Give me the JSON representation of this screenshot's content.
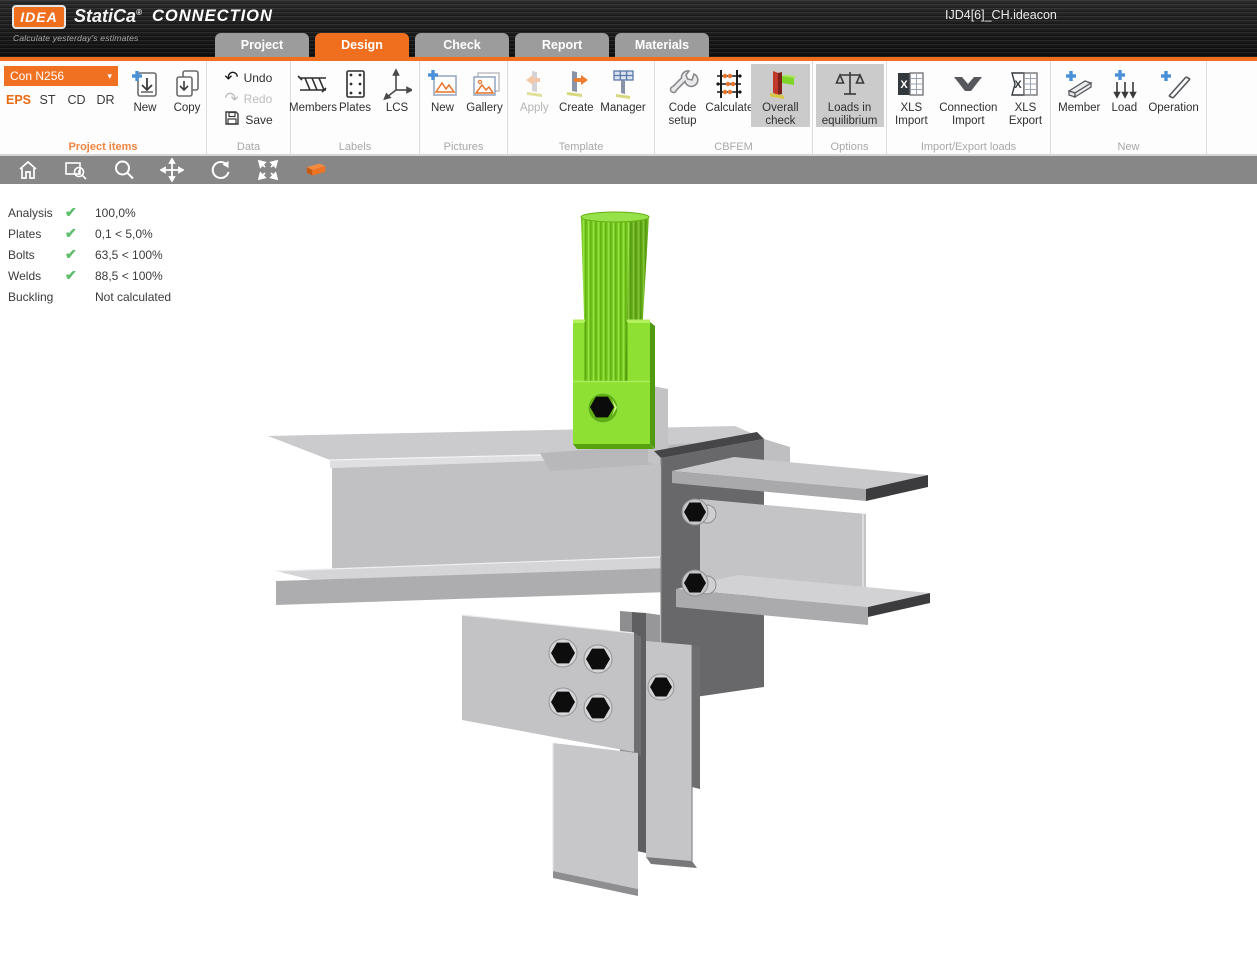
{
  "header": {
    "logo_primary": "IDEA",
    "logo_secondary": "StatiCa",
    "logo_trademark": "®",
    "tagline": "Calculate yesterday's estimates",
    "app_name": "CONNECTION",
    "document_title": "IJD4[6]_CH.ideacon",
    "tabs": [
      {
        "label": "Project"
      },
      {
        "label": "Design"
      },
      {
        "label": "Check"
      },
      {
        "label": "Report"
      },
      {
        "label": "Materials"
      }
    ]
  },
  "ribbon": {
    "project_items": {
      "caption": "Project items",
      "item_selector": "Con N256",
      "dropdown_arrow": "▾",
      "modes": [
        "EPS",
        "ST",
        "CD",
        "DR"
      ],
      "new_label": "New",
      "copy_label": "Copy"
    },
    "data_group": {
      "caption": "Data",
      "undo": "Undo",
      "redo": "Redo",
      "save": "Save",
      "undo_glyph": "↶",
      "redo_glyph": "↷"
    },
    "labels_group": {
      "caption": "Labels",
      "members": "Members",
      "plates": "Plates",
      "lcs": "LCS"
    },
    "pictures": {
      "caption": "Pictures",
      "new": "New",
      "gallery": "Gallery"
    },
    "template": {
      "caption": "Template",
      "apply": "Apply",
      "create": "Create",
      "manager": "Manager"
    },
    "cbfem": {
      "caption": "CBFEM",
      "code_setup": "Code setup",
      "calculate": "Calculate",
      "overall_check": "Overall check"
    },
    "options": {
      "caption": "Options",
      "loads_in_equilibrium": "Loads in equilibrium"
    },
    "import_export": {
      "caption": "Import/Export loads",
      "xls_import": "XLS Import",
      "connection_import": "Connection Import",
      "xls_export": "XLS Export"
    },
    "new_group": {
      "caption": "New",
      "member": "Member",
      "load": "Load",
      "operation": "Operation"
    }
  },
  "results": {
    "check_glyph": "✔",
    "rows": [
      {
        "label": "Analysis",
        "value": "100,0%",
        "passed": true
      },
      {
        "label": "Plates",
        "value": "0,1 < 5,0%",
        "passed": true
      },
      {
        "label": "Bolts",
        "value": "63,5 < 100%",
        "passed": true
      },
      {
        "label": "Welds",
        "value": "88,5 < 100%",
        "passed": true
      },
      {
        "label": "Buckling",
        "value": "Not calculated",
        "passed": null
      }
    ]
  },
  "colors": {
    "accent_orange": "#f06f1f",
    "check_green": "#5cbe6b",
    "member_green": "#7fd428",
    "steel_light": "#c6c6c9",
    "steel_dark": "#68686b"
  }
}
